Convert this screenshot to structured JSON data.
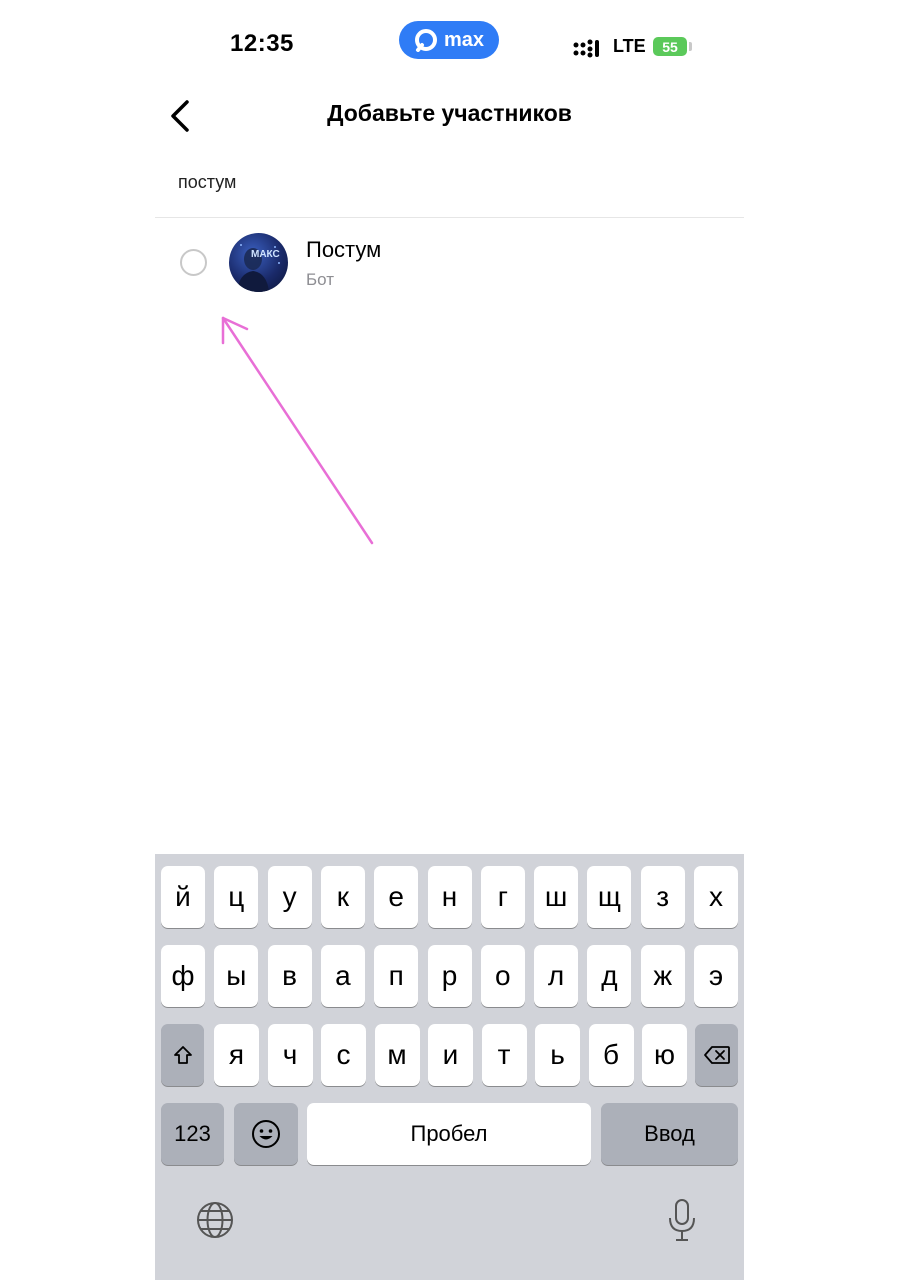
{
  "status_bar": {
    "time": "12:35",
    "app_pill_label": "max",
    "network": "LTE",
    "battery": "55"
  },
  "header": {
    "back_icon": "chevron-left-icon",
    "title": "Добавьте участников"
  },
  "search": {
    "value": "постум"
  },
  "results": [
    {
      "name": "Постум",
      "subtitle": "Бот",
      "avatar_text": "МАКС",
      "selected": false
    }
  ],
  "annotation": {
    "arrow_color": "#e86fd6"
  },
  "keyboard": {
    "row1": [
      "й",
      "ц",
      "у",
      "к",
      "е",
      "н",
      "г",
      "ш",
      "щ",
      "з",
      "х"
    ],
    "row2": [
      "ф",
      "ы",
      "в",
      "а",
      "п",
      "р",
      "о",
      "л",
      "д",
      "ж",
      "э"
    ],
    "row3": [
      "я",
      "ч",
      "с",
      "м",
      "и",
      "т",
      "ь",
      "б",
      "ю"
    ],
    "numbers_key": "123",
    "space_key": "Пробел",
    "return_key": "Ввод",
    "shift_icon": "shift-icon",
    "backspace_icon": "backspace-icon",
    "emoji_icon": "emoji-icon",
    "globe_icon": "globe-icon",
    "mic_icon": "microphone-icon"
  },
  "colors": {
    "accent": "#2f7cf6",
    "battery": "#5bc95a",
    "keyboard_bg": "#d1d3d9"
  }
}
